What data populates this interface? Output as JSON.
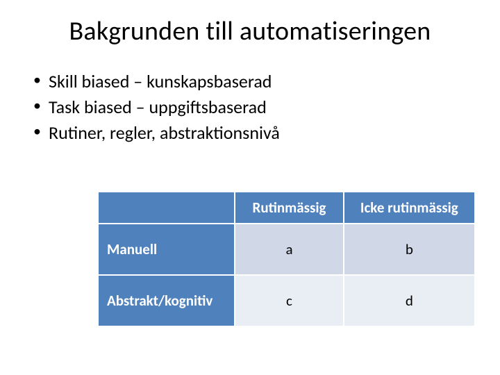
{
  "title": "Bakgrunden till automatiseringen",
  "bullets": [
    "Skill biased – kunskapsbaserad",
    "Task biased – uppgiftsbaserad",
    "Rutiner, regler, abstraktionsnivå"
  ],
  "chart_data": {
    "type": "table",
    "columns": [
      "Rutinmässig",
      "Icke rutinmässig"
    ],
    "rows": [
      "Manuell",
      "Abstrakt/kognitiv"
    ],
    "cells": [
      [
        "a",
        "b"
      ],
      [
        "c",
        "d"
      ]
    ]
  }
}
